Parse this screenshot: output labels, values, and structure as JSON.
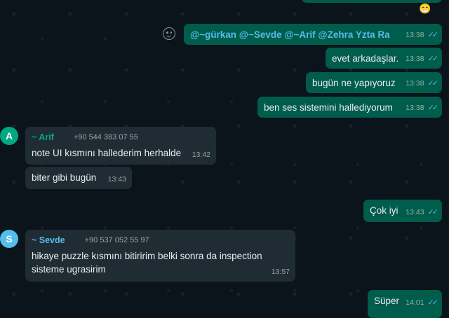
{
  "colors": {
    "outgoing_bubble": "#005c4b",
    "incoming_bubble": "#202c33",
    "background": "#0b141a",
    "read_ticks": "#53bdeb",
    "arif_name": "#00a884",
    "sevde_name": "#53bdeb"
  },
  "top_reaction": {
    "emoji": "😁"
  },
  "messages": {
    "m1": {
      "mentions": "@~gürkan @~Sevde @~Arif @Zehra Yzta Ra",
      "time": "13:38",
      "status_icon": "double-check-icon"
    },
    "m2": {
      "text": "evet arkadaşlar.",
      "time": "13:38"
    },
    "m3": {
      "text": "bugün ne yapıyoruz",
      "time": "13:38"
    },
    "m4": {
      "text": "ben ses sistemini hallediyorum",
      "time": "13:38"
    },
    "m5": {
      "avatar": "A",
      "sender": "~ Arif",
      "phone": "+90 544 383 07 55",
      "text": "note UI kısmını hallederim herhalde",
      "time": "13:42"
    },
    "m6": {
      "text": "biter gibi bugün",
      "time": "13:43"
    },
    "m7": {
      "text": "Çok iyi",
      "time": "13:43"
    },
    "m8": {
      "avatar": "S",
      "sender": "~ Sevde",
      "phone": "+90 537 052 55 97",
      "text_line1": "hikaye puzzle kısmını bitiririm belki sonra da inspection",
      "text_line2": "sisteme ugrasirim",
      "time": "13:57"
    },
    "m9": {
      "text": "Süper",
      "time": "14:01"
    }
  },
  "ticks_glyph": "✓✓"
}
